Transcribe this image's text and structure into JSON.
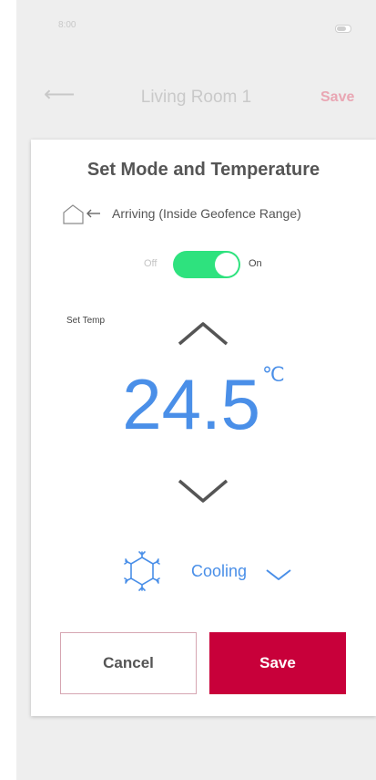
{
  "status_bar": {
    "time": "8:00"
  },
  "header": {
    "title": "Living Room 1",
    "save_label": "Save"
  },
  "card": {
    "title": "Set Mode and Temperature",
    "arriving_label": "Arriving  (Inside Geofence Range)",
    "toggle": {
      "off_label": "Off",
      "on_label": "On",
      "state": "on"
    },
    "set_temp_label": "Set Temp",
    "temperature": {
      "value": "24.5",
      "unit": "℃"
    },
    "mode": {
      "label": "Cooling"
    },
    "cancel_label": "Cancel",
    "save_label": "Save"
  },
  "colors": {
    "accent_blue": "#4a8fe8",
    "toggle_green": "#2ee27e",
    "save_red": "#c8003a"
  },
  "icons": [
    "back-arrow-icon",
    "battery-icon",
    "house-arrow-icon",
    "chevron-up-icon",
    "chevron-down-icon",
    "snowflake-icon"
  ]
}
